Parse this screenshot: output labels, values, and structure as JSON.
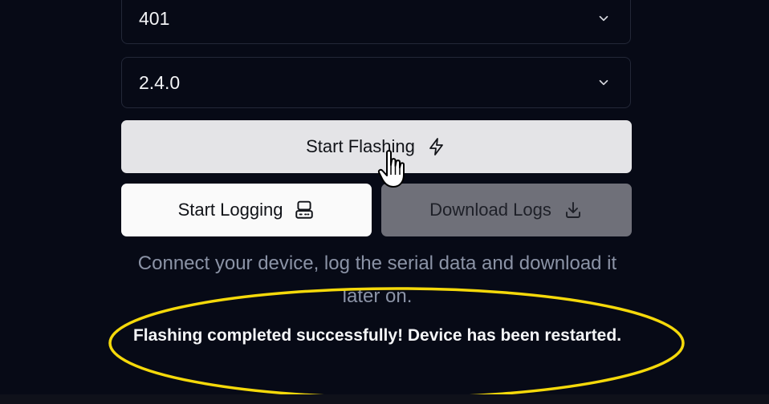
{
  "selects": {
    "model": {
      "value": "401",
      "icon": "chevron-down-icon"
    },
    "version": {
      "value": "2.4.0",
      "icon": "chevron-down-icon"
    }
  },
  "buttons": {
    "flash": {
      "label": "Start Flashing",
      "icon": "lightning-bolt-icon"
    },
    "log": {
      "label": "Start Logging",
      "icon": "serial-device-icon"
    },
    "download": {
      "label": "Download Logs",
      "icon": "download-icon"
    }
  },
  "info_text": "Connect your device, log the serial data and download it later on.",
  "status": {
    "message": "Flashing completed successfully! Device has been restarted."
  },
  "colors": {
    "background": "#070a16",
    "highlight_ellipse": "#f5d90a",
    "muted_text": "#8b93a6"
  }
}
